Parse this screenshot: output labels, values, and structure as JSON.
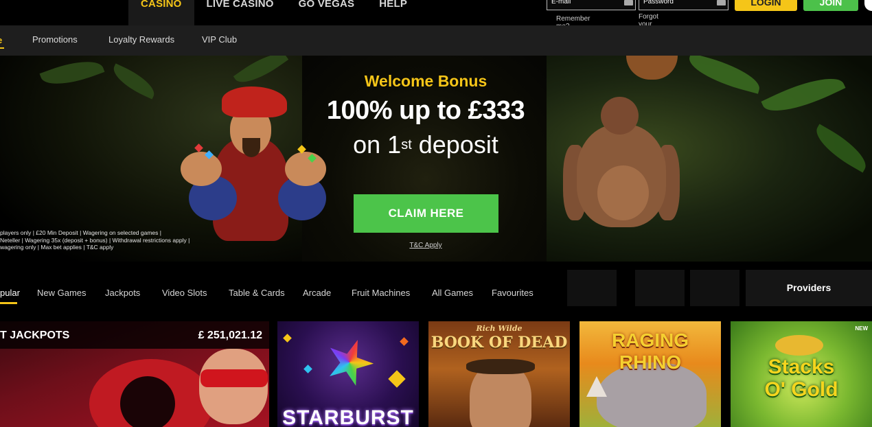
{
  "main_nav": [
    {
      "label": "CASINO",
      "active": true
    },
    {
      "label": "LIVE CASINO",
      "active": false
    },
    {
      "label": "GO VEGAS",
      "active": false
    },
    {
      "label": "HELP",
      "active": false
    }
  ],
  "login": {
    "email_placeholder": "E-mail",
    "password_placeholder": "Password",
    "remember_me": "Remember me?",
    "forgot_password": "Forgot your password?",
    "login_label": "LOGIN",
    "join_label": "JOIN"
  },
  "sub_nav": {
    "home_label": "e",
    "items": [
      "Promotions",
      "Loyalty Rewards",
      "VIP Club"
    ]
  },
  "hero": {
    "title": "Welcome Bonus",
    "amount": "100% up to £333",
    "deposit_prefix": "on 1",
    "deposit_sup": "st",
    "deposit_suffix": " deposit",
    "claim_label": "CLAIM HERE",
    "tc_label": "T&C Apply",
    "terms_lines": [
      "players only | £20 Min Deposit | Wagering on selected games |",
      "Neteller | Wagering 35x (deposit + bonus) | Withdrawal restrictions apply |",
      "wagering only | Max bet applies | T&C apply"
    ]
  },
  "game_tabs": [
    "pular",
    "New Games",
    "Jackpots",
    "Video Slots",
    "Table & Cards",
    "Arcade",
    "Fruit Machines",
    "All Games",
    "Favourites"
  ],
  "providers_label": "Providers",
  "tiles": {
    "jackpot_label": "T JACKPOTS",
    "jackpot_amount": "£ 251,021.12",
    "starburst_title": "STARBURST",
    "bod_author": "Rich Wilde",
    "bod_title": "BOOK OF DEAD",
    "rhino_title": "RAGING RHINO",
    "stacks_title_1": "Stacks",
    "stacks_title_2": "O' Gold",
    "new_badge": "NEW"
  },
  "colors": {
    "accent_yellow": "#f5c518",
    "join_green": "#4cc14a",
    "claim_green": "#4cc44a"
  }
}
